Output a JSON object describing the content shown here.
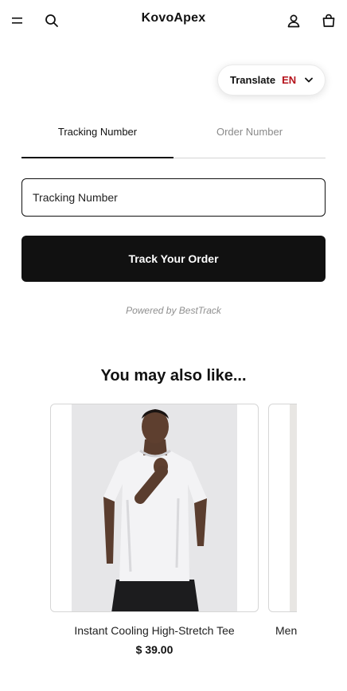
{
  "header": {
    "logo": "KovoApex",
    "icons": [
      "menu-icon",
      "search-icon",
      "account-icon",
      "cart-icon"
    ]
  },
  "translate": {
    "label": "Translate",
    "language": "EN",
    "accent_color": "#b5121b"
  },
  "tabs": [
    {
      "label": "Tracking Number",
      "active": true
    },
    {
      "label": "Order Number",
      "active": false
    }
  ],
  "tracking_input": {
    "placeholder": "Tracking Number",
    "value": ""
  },
  "track_button": {
    "label": "Track Your Order"
  },
  "powered_by": "Powered by BestTrack",
  "recommendations": {
    "title": "You may also like...",
    "products": [
      {
        "name": "Instant Cooling High-Stretch Tee",
        "price": "$ 39.00"
      },
      {
        "name": "Men",
        "price": ""
      }
    ]
  }
}
